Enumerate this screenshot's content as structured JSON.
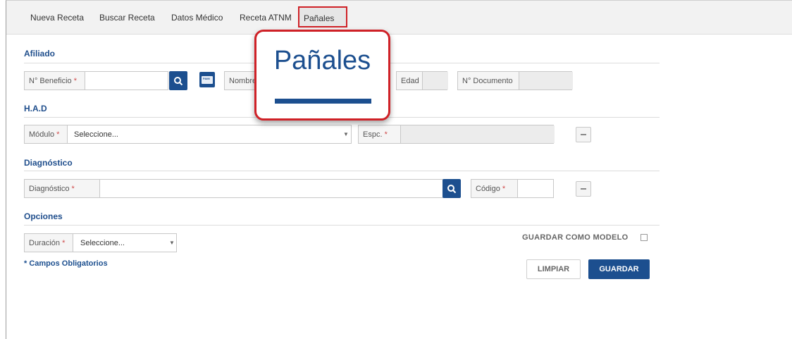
{
  "nav": {
    "tabs": [
      {
        "label": "Nueva Receta"
      },
      {
        "label": "Buscar Receta"
      },
      {
        "label": "Datos Médico"
      },
      {
        "label": "Receta ATNM"
      },
      {
        "label": "Pañales",
        "active": true
      }
    ]
  },
  "afiliado": {
    "title": "Afiliado",
    "beneficio_label": "N° Beneficio",
    "required_mark": "*",
    "beneficio_value": "",
    "pami_icon": "PAMI",
    "nombre_label": "Nombre",
    "edad_label": "Edad",
    "documento_label": "N° Documento"
  },
  "had": {
    "title": "H.A.D",
    "modulo_label": "Módulo",
    "modulo_selected": "Seleccione...",
    "espc_label": "Espc."
  },
  "diagnostico": {
    "title": "Diagnóstico",
    "diag_label": "Diagnóstico",
    "codigo_label": "Código"
  },
  "opciones": {
    "title": "Opciones",
    "duracion_label": "Duración",
    "duracion_selected": "Seleccione...",
    "guardar_modelo_label": "GUARDAR COMO MODELO",
    "campos_obligatorios": "* Campos Obligatorios"
  },
  "actions": {
    "limpiar": "LIMPIAR",
    "guardar": "GUARDAR"
  },
  "callout": {
    "text": "Pañales"
  },
  "colors": {
    "accent": "#1c4f8f",
    "highlight_red": "#cf2127",
    "required": "#d04a4a"
  }
}
